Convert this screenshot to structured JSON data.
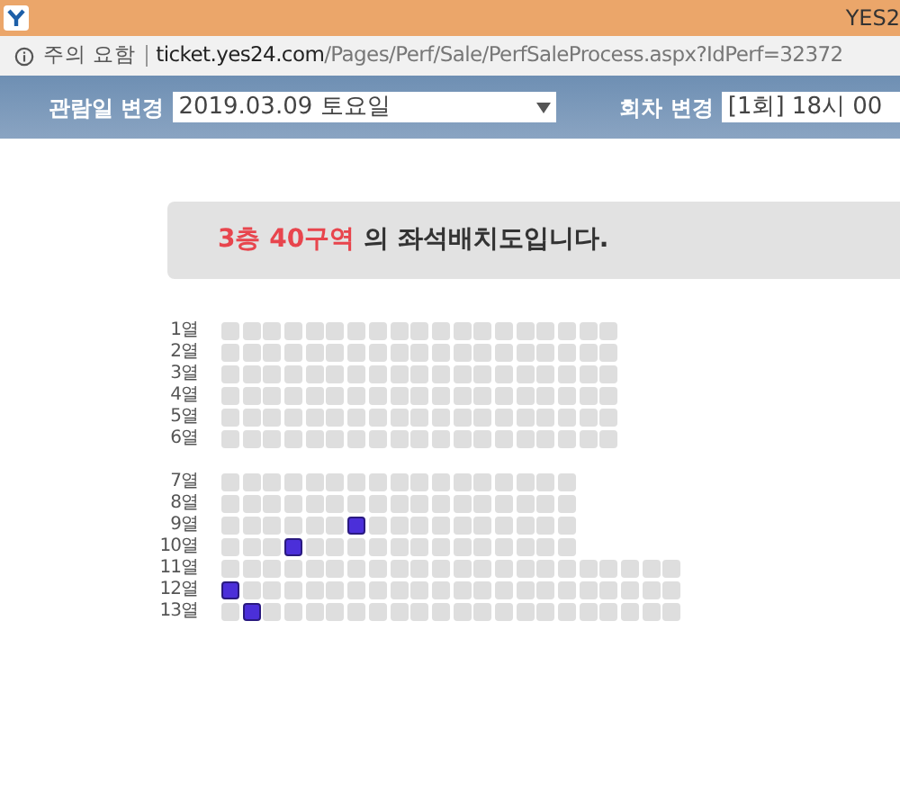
{
  "title_bar": {
    "title": "YES2"
  },
  "address_bar": {
    "security": "주의 요함",
    "url_host": "ticket.yes24.com",
    "url_path": "/Pages/Perf/Sale/PerfSaleProcess.aspx?IdPerf=32372"
  },
  "toolbar": {
    "date_label": "관람일 변경",
    "date_value": "2019.03.09 토요일",
    "round_label": "회차 변경",
    "round_value": "[1회] 18시 00"
  },
  "banner": {
    "highlight": "3층 40구역",
    "text": " 의 좌석배치도입니다."
  },
  "blocks": [
    {
      "rows": [
        {
          "label": "1열",
          "seats": [
            false,
            false,
            false,
            false,
            false,
            false,
            false,
            false,
            false,
            false,
            false,
            false,
            false,
            false,
            false,
            false,
            false,
            false,
            false
          ]
        },
        {
          "label": "2열",
          "seats": [
            false,
            false,
            false,
            false,
            false,
            false,
            false,
            false,
            false,
            false,
            false,
            false,
            false,
            false,
            false,
            false,
            false,
            false,
            false
          ]
        },
        {
          "label": "3열",
          "seats": [
            false,
            false,
            false,
            false,
            false,
            false,
            false,
            false,
            false,
            false,
            false,
            false,
            false,
            false,
            false,
            false,
            false,
            false,
            false
          ]
        },
        {
          "label": "4열",
          "seats": [
            false,
            false,
            false,
            false,
            false,
            false,
            false,
            false,
            false,
            false,
            false,
            false,
            false,
            false,
            false,
            false,
            false,
            false,
            false
          ]
        },
        {
          "label": "5열",
          "seats": [
            false,
            false,
            false,
            false,
            false,
            false,
            false,
            false,
            false,
            false,
            false,
            false,
            false,
            false,
            false,
            false,
            false,
            false,
            false
          ]
        },
        {
          "label": "6열",
          "seats": [
            false,
            false,
            false,
            false,
            false,
            false,
            false,
            false,
            false,
            false,
            false,
            false,
            false,
            false,
            false,
            false,
            false,
            false,
            false
          ]
        }
      ]
    },
    {
      "rows": [
        {
          "label": "7열",
          "seats": [
            false,
            false,
            false,
            false,
            false,
            false,
            false,
            false,
            false,
            false,
            false,
            false,
            false,
            false,
            false,
            false,
            false
          ]
        },
        {
          "label": "8열",
          "seats": [
            false,
            false,
            false,
            false,
            false,
            false,
            false,
            false,
            false,
            false,
            false,
            false,
            false,
            false,
            false,
            false,
            false
          ]
        },
        {
          "label": "9열",
          "seats": [
            false,
            false,
            false,
            false,
            false,
            false,
            true,
            false,
            false,
            false,
            false,
            false,
            false,
            false,
            false,
            false,
            false
          ]
        },
        {
          "label": "10열",
          "seats": [
            false,
            false,
            false,
            true,
            false,
            false,
            false,
            false,
            false,
            false,
            false,
            false,
            false,
            false,
            false,
            false,
            false
          ]
        },
        {
          "label": "11열",
          "seats": [
            false,
            false,
            false,
            false,
            false,
            false,
            false,
            false,
            false,
            false,
            false,
            false,
            false,
            false,
            false,
            false,
            false,
            false,
            false,
            false,
            false,
            false
          ]
        },
        {
          "label": "12열",
          "seats": [
            true,
            false,
            false,
            false,
            false,
            false,
            false,
            false,
            false,
            false,
            false,
            false,
            false,
            false,
            false,
            false,
            false,
            false,
            false,
            false,
            false,
            false
          ]
        },
        {
          "label": "13열",
          "seats": [
            false,
            true,
            false,
            false,
            false,
            false,
            false,
            false,
            false,
            false,
            false,
            false,
            false,
            false,
            false,
            false,
            false,
            false,
            false,
            false,
            false,
            false
          ]
        }
      ]
    }
  ]
}
